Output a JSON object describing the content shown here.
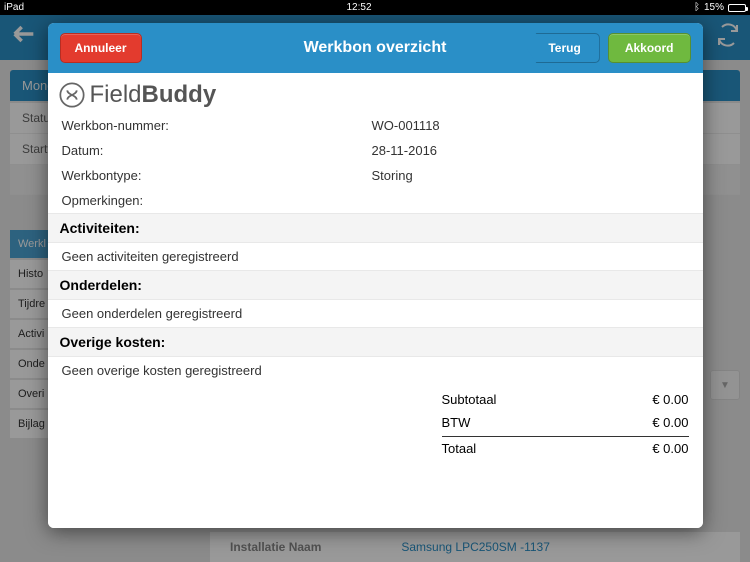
{
  "status_bar": {
    "carrier": "iPad",
    "time": "12:52",
    "battery": "15%"
  },
  "background": {
    "day_header": "Monda",
    "status_label": "Status",
    "starttime_label": "Starttij",
    "tabs": [
      "Werkl",
      "Histo",
      "Tijdre",
      "Activi",
      "Onde",
      "Overi",
      "Bijlag"
    ],
    "install_label": "Installatie Naam",
    "install_value": "Samsung LPC250SM -1137"
  },
  "modal": {
    "cancel": "Annuleer",
    "title": "Werkbon overzicht",
    "back": "Terug",
    "accept": "Akkoord",
    "logo_field": "Field",
    "logo_buddy": "Buddy",
    "fields": {
      "number_label": "Werkbon-nummer:",
      "number_value": "WO-001118",
      "date_label": "Datum:",
      "date_value": "28-11-2016",
      "type_label": "Werkbontype:",
      "type_value": "Storing",
      "remarks_label": "Opmerkingen:",
      "remarks_value": ""
    },
    "sections": {
      "activities_header": "Activiteiten:",
      "activities_empty": "Geen activiteiten geregistreerd",
      "parts_header": "Onderdelen:",
      "parts_empty": "Geen onderdelen geregistreerd",
      "costs_header": "Overige kosten:",
      "costs_empty": "Geen overige kosten geregistreerd"
    },
    "totals": {
      "subtotal_label": "Subtotaal",
      "subtotal_value": "€ 0.00",
      "vat_label": "BTW",
      "vat_value": "€ 0.00",
      "total_label": "Totaal",
      "total_value": "€ 0.00"
    }
  }
}
